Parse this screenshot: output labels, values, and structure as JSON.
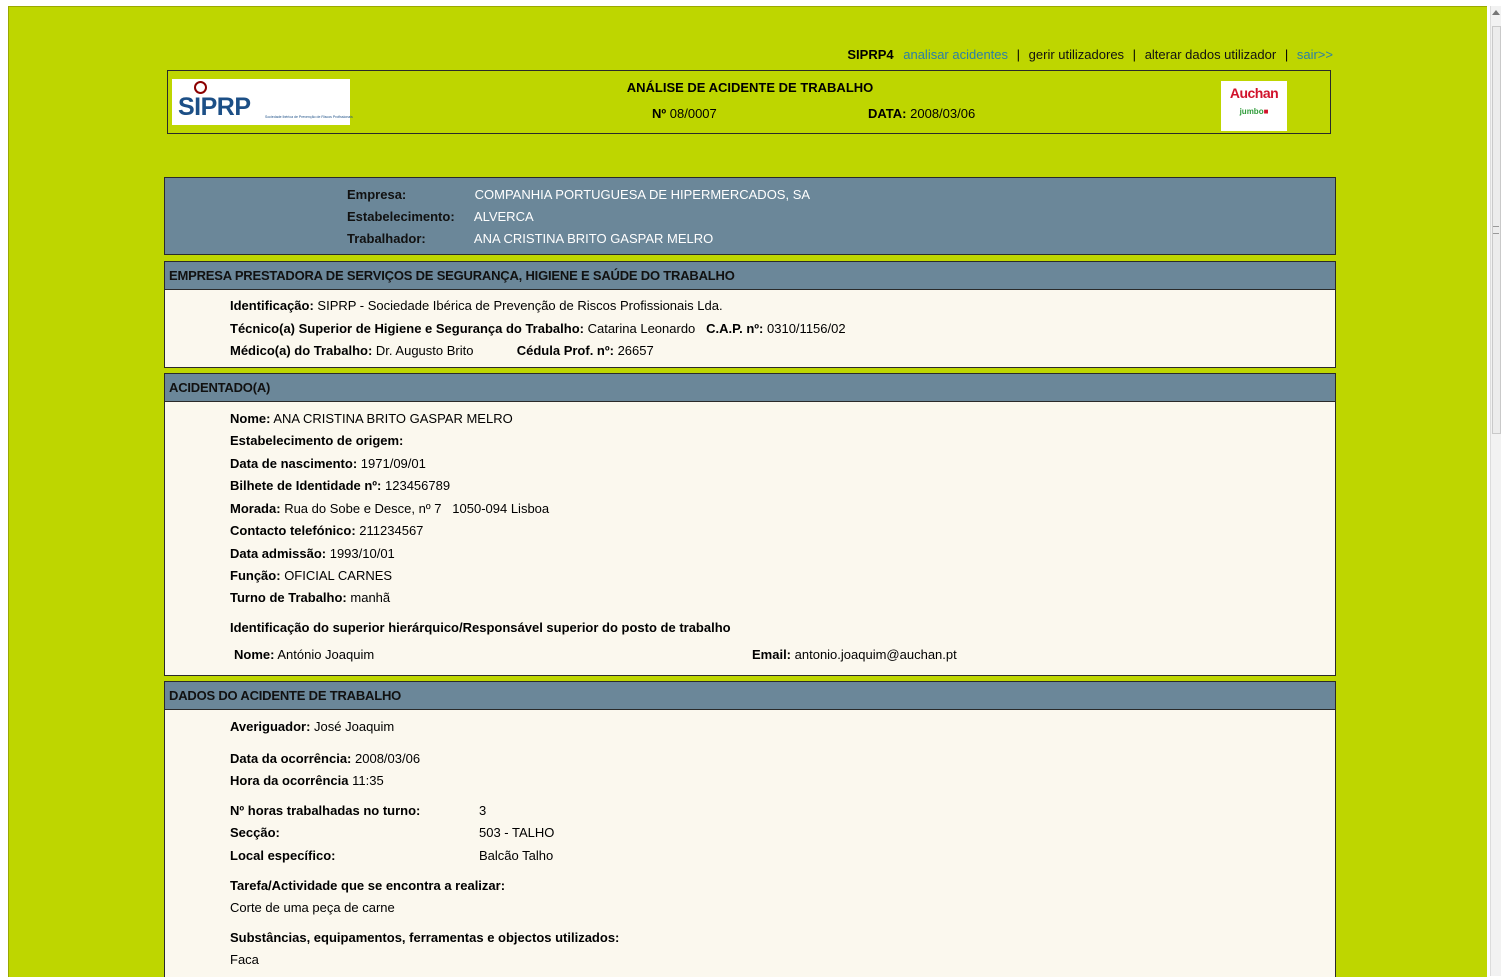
{
  "nav": {
    "brand": "SIPRP4",
    "analisar": "analisar acidentes",
    "gerir": "gerir utilizadores",
    "alterar": "alterar dados utilizador",
    "sair": "sair>>",
    "sep": "|"
  },
  "header": {
    "title": "ANÁLISE DE ACIDENTE DE TRABALHO",
    "num_label": "Nº",
    "num_value": "08/0007",
    "date_label": "DATA:",
    "date_value": "2008/03/06",
    "logo_siprp": "SIPRP",
    "logo_siprp_tag": "Sociedade Ibérica de Prevenção de Riscos Profissionais",
    "logo_auchan": "Auchan",
    "logo_jumbo": "jumbo"
  },
  "company": {
    "empresa_label": "Empresa:",
    "empresa": "COMPANHIA PORTUGUESA DE HIPERMERCADOS, SA",
    "estab_label": "Estabelecimento:",
    "estab": "ALVERCA",
    "trab_label": "Trabalhador:",
    "trab": "ANA CRISTINA BRITO GASPAR MELRO"
  },
  "prestadora": {
    "title": "EMPRESA PRESTADORA DE SERVIÇOS DE SEGURANÇA, HIGIENE E SAÚDE DO TRABALHO",
    "ident_label": "Identificação:",
    "ident": "SIPRP - Sociedade Ibérica de Prevenção de Riscos Profissionais Lda.",
    "tecnico_label": "Técnico(a) Superior de Higiene e Segurança do Trabalho:",
    "tecnico": "Catarina Leonardo",
    "cap_label": "C.A.P. nº:",
    "cap": "0310/1156/02",
    "medico_label": "Médico(a) do Trabalho:",
    "medico": "Dr. Augusto Brito",
    "cedula_label": "Cédula Prof. nº:",
    "cedula": "26657"
  },
  "acidentado": {
    "title": "ACIDENTADO(A)",
    "nome_label": "Nome:",
    "nome": "ANA CRISTINA BRITO GASPAR MELRO",
    "estab_origem_label": "Estabelecimento de origem:",
    "nasc_label": "Data de nascimento:",
    "nasc": "1971/09/01",
    "bi_label": "Bilhete de Identidade nº:",
    "bi": "123456789",
    "morada_label": "Morada:",
    "morada": "Rua do Sobe e Desce, nº 7",
    "codpostal": "1050-094 Lisboa",
    "contacto_label": "Contacto telefónico:",
    "contacto": "211234567",
    "admissao_label": "Data admissão:",
    "admissao": "1993/10/01",
    "funcao_label": "Função:",
    "funcao": "OFICIAL CARNES",
    "turno_label": "Turno de Trabalho:",
    "turno": "manhã",
    "superior_title": "Identificação do superior hierárquico/Responsável superior do posto de trabalho",
    "sup_nome_label": "Nome:",
    "sup_nome": "António Joaquim",
    "sup_email_label": "Email:",
    "sup_email": "antonio.joaquim@auchan.pt"
  },
  "dados": {
    "title": "DADOS DO ACIDENTE DE TRABALHO",
    "averiguador_label": "Averiguador:",
    "averiguador": "José Joaquim",
    "data_label": "Data da ocorrência:",
    "data": "2008/03/06",
    "hora_label": "Hora da ocorrência",
    "hora": "11:35",
    "horas_label": "Nº horas trabalhadas no turno:",
    "horas": "3",
    "seccao_label": "Secção:",
    "seccao": "503 - TALHO",
    "local_label": "Local específico:",
    "local": "Balcão Talho",
    "tarefa_label": "Tarefa/Actividade que se encontra a realizar:",
    "tarefa": "Corte de uma peça de carne",
    "subst_label": "Substâncias, equipamentos, ferramentas e objectos utilizados:",
    "subst": "Faca"
  }
}
